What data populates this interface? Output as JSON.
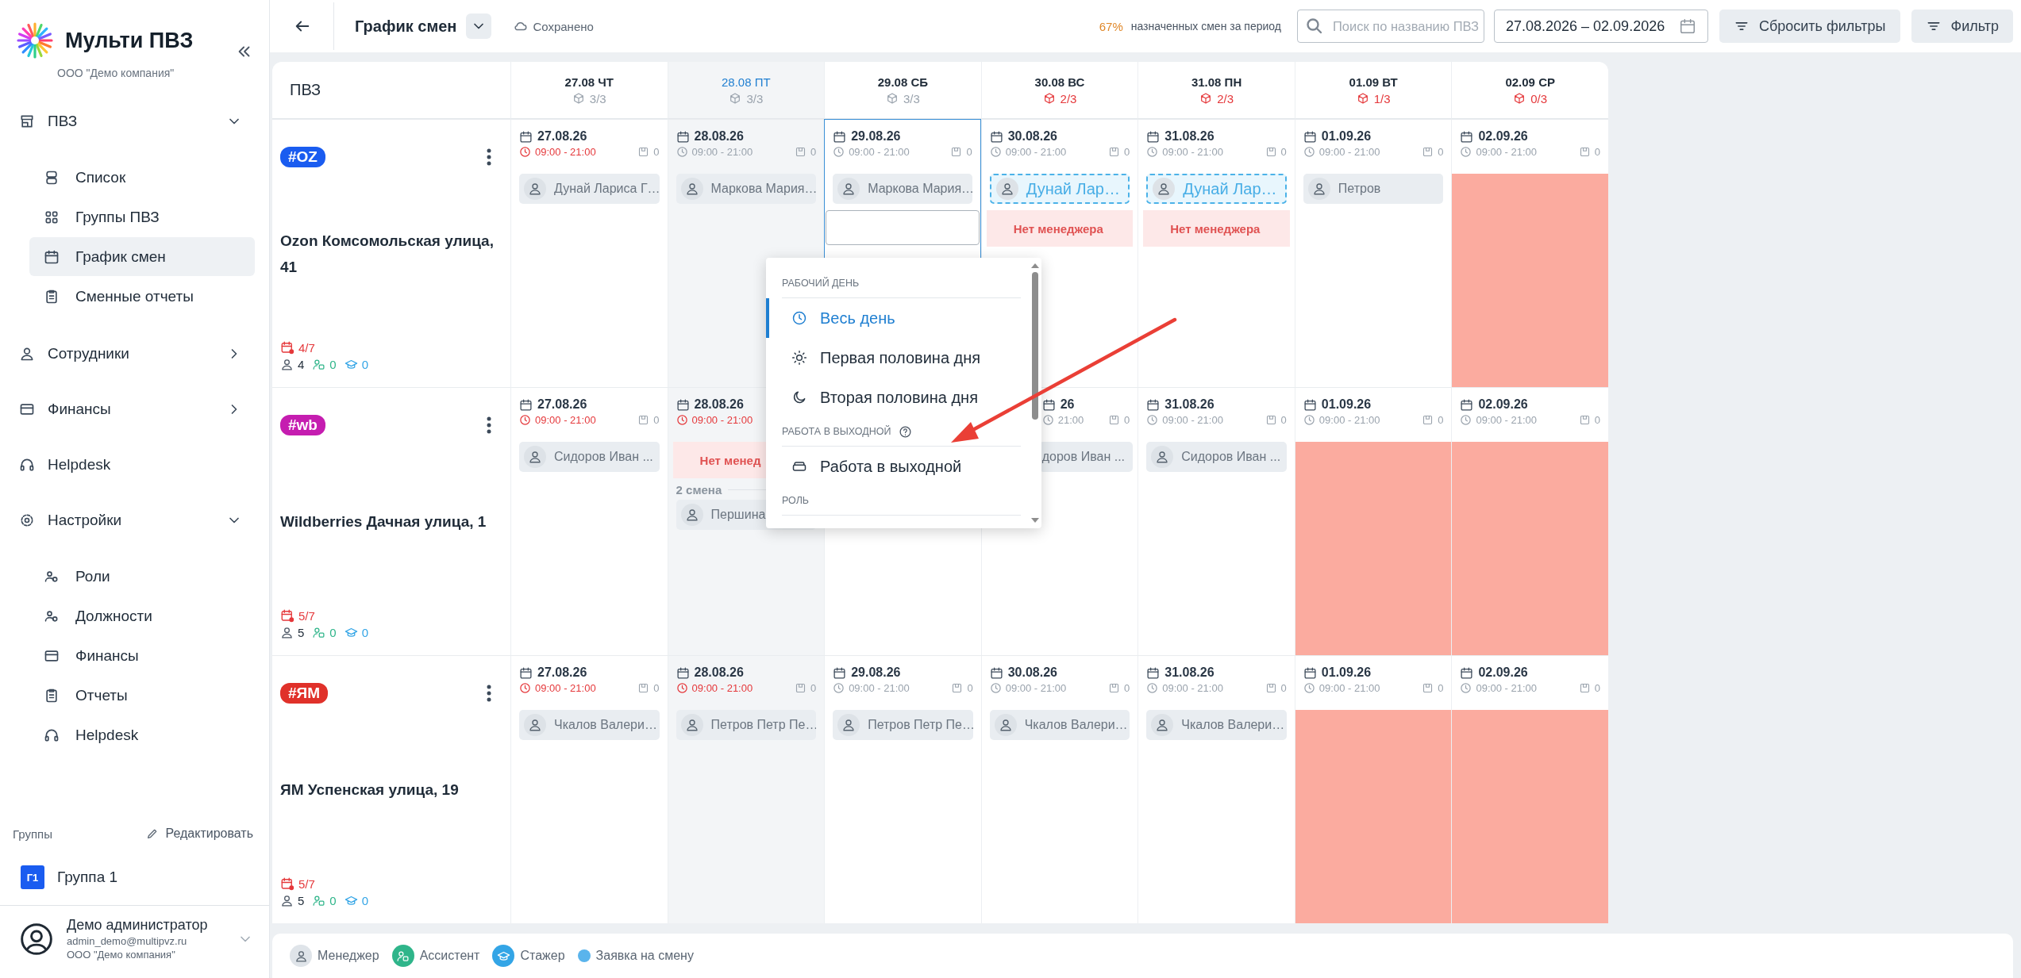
{
  "sidebar": {
    "brand": "Мульти ПВЗ",
    "company": "ООО \"Демо компания\"",
    "nav": [
      {
        "label": "ПВЗ",
        "selected": false,
        "expanded": true,
        "children": [
          {
            "label": "Список",
            "selected": false
          },
          {
            "label": "Группы ПВЗ",
            "selected": false
          },
          {
            "label": "График смен",
            "selected": true
          },
          {
            "label": "Сменные отчеты",
            "selected": false
          }
        ]
      },
      {
        "label": "Сотрудники",
        "selected": false,
        "expanded": false
      },
      {
        "label": "Финансы",
        "selected": false,
        "expanded": false
      },
      {
        "label": "Helpdesk",
        "selected": false
      },
      {
        "label": "Настройки",
        "selected": false,
        "expanded": true,
        "children": [
          {
            "label": "Роли",
            "selected": false
          },
          {
            "label": "Должности",
            "selected": false
          },
          {
            "label": "Финансы",
            "selected": false
          },
          {
            "label": "Отчеты",
            "selected": false
          },
          {
            "label": "Helpdesk",
            "selected": false
          }
        ]
      }
    ],
    "groups": {
      "title": "Группы",
      "edit": "Редактировать",
      "items": [
        {
          "badge": "Г1",
          "name": "Группа 1"
        }
      ]
    },
    "user": {
      "name": "Демо администратор",
      "email": "admin_demo@multipvz.ru",
      "company": "ООО \"Демо компания\""
    }
  },
  "topbar": {
    "title": "График смен",
    "status": "Сохранено",
    "percent": "67%",
    "percent_text": "назначенных смен за период",
    "search": {
      "placeholder": "Поиск по названию ПВЗ"
    },
    "date_range": "27.08.2026 – 02.09.2026",
    "buttons": [
      "Сбросить фильтры",
      "Фильтр"
    ]
  },
  "schedule": {
    "corner": "ПВЗ",
    "days": [
      {
        "label": "27.08 ЧТ",
        "count": "3/3",
        "short": false,
        "today": false
      },
      {
        "label": "28.08 ПТ",
        "count": "3/3",
        "short": false,
        "today": true
      },
      {
        "label": "29.08 СБ",
        "count": "3/3",
        "short": false,
        "today": false
      },
      {
        "label": "30.08 ВС",
        "count": "2/3",
        "short": true,
        "today": false
      },
      {
        "label": "31.08 ПН",
        "count": "2/3",
        "short": true,
        "today": false
      },
      {
        "label": "01.09 ВТ",
        "count": "1/3",
        "short": true,
        "today": false
      },
      {
        "label": "02.09 СР",
        "count": "0/3",
        "short": true,
        "today": false
      }
    ],
    "rows": [
      {
        "tag": "#OZ",
        "color": "#1a5cf0",
        "name": "Ozon Комсомольская улица, 41",
        "days_filled": "4/7",
        "managers": "4",
        "assistants": "0",
        "trainees": "0",
        "cells": [
          {
            "date": "27.08.26",
            "time": "09:00 - 21:00",
            "time_alert": true,
            "count": "0",
            "selected": false,
            "closed": false,
            "entries": [
              {
                "kind": "employee",
                "text": "Дунай Лариса Г…"
              }
            ]
          },
          {
            "date": "28.08.26",
            "time": "09:00 - 21:00",
            "time_alert": false,
            "count": "0",
            "selected": false,
            "closed": false,
            "entries": [
              {
                "kind": "employee",
                "text": "Маркова Мария…"
              }
            ]
          },
          {
            "date": "29.08.26",
            "time": "09:00 - 21:00",
            "time_alert": false,
            "count": "0",
            "selected": true,
            "closed": false,
            "entries": [
              {
                "kind": "employee",
                "text": "Маркова Мария…"
              },
              {
                "kind": "slot"
              }
            ]
          },
          {
            "date": "30.08.26",
            "time": "09:00 - 21:00",
            "time_alert": false,
            "count": "0",
            "selected": false,
            "closed": false,
            "entries": [
              {
                "kind": "request",
                "text": "Дунай Лар…"
              },
              {
                "kind": "warning",
                "text": "Нет менеджера"
              }
            ]
          },
          {
            "date": "31.08.26",
            "time": "09:00 - 21:00",
            "time_alert": false,
            "count": "0",
            "selected": false,
            "closed": false,
            "entries": [
              {
                "kind": "request",
                "text": "Дунай Лар…"
              },
              {
                "kind": "warning",
                "text": "Нет менеджера"
              }
            ]
          },
          {
            "date": "01.09.26",
            "time": "09:00 - 21:00",
            "time_alert": false,
            "count": "0",
            "selected": false,
            "closed": false,
            "entries": [
              {
                "kind": "employee",
                "text": "Петров"
              }
            ]
          },
          {
            "date": "02.09.26",
            "time": "09:00 - 21:00",
            "time_alert": false,
            "count": "0",
            "selected": false,
            "closed": true
          }
        ]
      },
      {
        "tag": "#wb",
        "color": "#c51db0",
        "name": "Wildberries Дачная улица, 1",
        "days_filled": "5/7",
        "managers": "5",
        "assistants": "0",
        "trainees": "0",
        "cells": [
          {
            "date": "27.08.26",
            "time": "09:00 - 21:00",
            "time_alert": true,
            "count": "0",
            "selected": false,
            "closed": false,
            "entries": [
              {
                "kind": "employee",
                "text": "Сидоров Иван ..."
              }
            ]
          },
          {
            "date": "28.08.26",
            "time": "09:00 - 21:00",
            "time_alert": true,
            "selected": false,
            "closed": false,
            "entries": [
              {
                "kind": "warning",
                "text": "Нет менед"
              },
              {
                "kind": "shift_label",
                "text": "2 смена"
              },
              {
                "kind": "employee",
                "text": "Першина"
              }
            ]
          },
          {
            "selected": false,
            "closed": false
          },
          {
            "date": "26",
            "time": "21:00",
            "time_alert": false,
            "count": "0",
            "selected": false,
            "closed": false,
            "clipped_left": true,
            "entries": [
              {
                "kind": "employee",
                "text": "доров Иван ..."
              }
            ]
          },
          {
            "date": "31.08.26",
            "time": "09:00 - 21:00",
            "time_alert": false,
            "count": "0",
            "selected": false,
            "closed": false,
            "entries": [
              {
                "kind": "employee",
                "text": "Сидоров Иван ..."
              }
            ]
          },
          {
            "date": "01.09.26",
            "time": "09:00 - 21:00",
            "time_alert": false,
            "count": "0",
            "selected": false,
            "closed": true
          },
          {
            "date": "02.09.26",
            "time": "09:00 - 21:00",
            "time_alert": false,
            "count": "0",
            "selected": false,
            "closed": true
          }
        ]
      },
      {
        "tag": "#ЯМ",
        "color": "#e0312a",
        "name": "ЯМ Успенская улица, 19",
        "days_filled": "5/7",
        "managers": "5",
        "assistants": "0",
        "trainees": "0",
        "cells": [
          {
            "date": "27.08.26",
            "time": "09:00 - 21:00",
            "time_alert": true,
            "count": "0",
            "selected": false,
            "closed": false,
            "entries": [
              {
                "kind": "employee",
                "text": "Чкалов Валери…"
              }
            ]
          },
          {
            "date": "28.08.26",
            "time": "09:00 - 21:00",
            "time_alert": true,
            "count": "0",
            "selected": false,
            "closed": false,
            "entries": [
              {
                "kind": "employee",
                "text": "Петров Петр Пе…"
              }
            ]
          },
          {
            "date": "29.08.26",
            "time": "09:00 - 21:00",
            "time_alert": false,
            "count": "0",
            "selected": false,
            "closed": false,
            "entries": [
              {
                "kind": "employee",
                "text": "Петров Петр Пе…"
              }
            ]
          },
          {
            "date": "30.08.26",
            "time": "09:00 - 21:00",
            "time_alert": false,
            "count": "0",
            "selected": false,
            "closed": false,
            "entries": [
              {
                "kind": "employee",
                "text": "Чкалов Валери…"
              }
            ]
          },
          {
            "date": "31.08.26",
            "time": "09:00 - 21:00",
            "time_alert": false,
            "count": "0",
            "selected": false,
            "closed": false,
            "entries": [
              {
                "kind": "employee",
                "text": "Чкалов Валери…"
              }
            ]
          },
          {
            "date": "01.09.26",
            "time": "09:00 - 21:00",
            "time_alert": false,
            "count": "0",
            "selected": false,
            "closed": true
          },
          {
            "date": "02.09.26",
            "time": "09:00 - 21:00",
            "time_alert": false,
            "count": "0",
            "selected": false,
            "closed": true
          }
        ]
      }
    ]
  },
  "popup": {
    "items": [
      {
        "kind": "section",
        "label": "РАБОЧИЙ ДЕНЬ",
        "help": false
      },
      {
        "kind": "option",
        "label": "Весь день",
        "selected": true
      },
      {
        "kind": "option",
        "label": "Первая половина дня",
        "selected": false
      },
      {
        "kind": "option",
        "label": "Вторая половина дня",
        "selected": false
      },
      {
        "kind": "section",
        "label": "РАБОТА В ВЫХОДНОЙ",
        "help": true
      },
      {
        "kind": "option",
        "label": "Работа в выходной",
        "selected": false
      },
      {
        "kind": "section",
        "label": "РОЛЬ",
        "help": false
      }
    ]
  },
  "legend": [
    {
      "kind": "manager",
      "label": "Менеджер"
    },
    {
      "kind": "assistant",
      "label": "Ассистент"
    },
    {
      "kind": "trainee",
      "label": "Стажер"
    },
    {
      "kind": "request",
      "label": "Заявка на смену"
    }
  ]
}
